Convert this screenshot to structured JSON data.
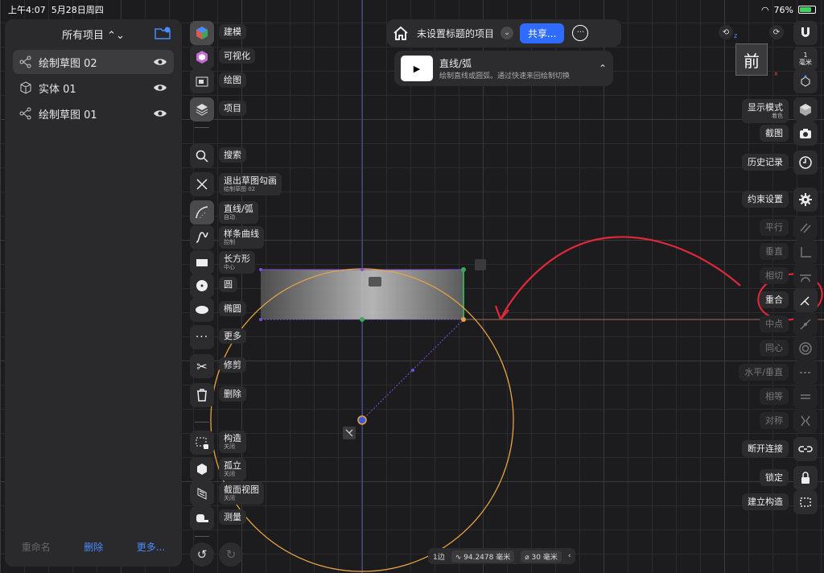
{
  "status_bar": {
    "time": "上午4:07",
    "date": "5月28日周四",
    "battery": "76%",
    "battery_level": 0.76
  },
  "left_panel": {
    "header": "所有项目 ⌃⌄",
    "items": [
      {
        "label": "绘制草图 02",
        "icon": "sketch-icon",
        "selected": true
      },
      {
        "label": "实体  01",
        "icon": "cube-icon",
        "selected": false
      },
      {
        "label": "绘制草图 01",
        "icon": "sketch-icon",
        "selected": false
      }
    ],
    "footer": {
      "rename": "重命名",
      "delete": "删除",
      "more": "更多..."
    }
  },
  "tools": {
    "modeling": "建模",
    "visualize": "可视化",
    "drawing": "绘图",
    "project": "项目",
    "search": "搜索",
    "exit_sketch": "退出草图勾画",
    "exit_sketch_sub": "绘制草图 02",
    "line_arc": "直线/弧",
    "line_arc_sub": "自动",
    "spline": "样条曲线",
    "spline_sub": "控制",
    "rectangle": "长方形",
    "rectangle_sub": "中心",
    "circle": "圆",
    "ellipse": "椭圆",
    "more": "更多",
    "trim": "修剪",
    "delete": "删除",
    "construct": "构造",
    "construct_sub": "关闭",
    "isolate": "孤立",
    "isolate_sub": "关闭",
    "section": "截面视图",
    "section_sub": "关闭",
    "measure": "测量"
  },
  "topbar": {
    "title": "未设置标题的项目",
    "share": "共享...",
    "more_icon": "ellipsis-icon"
  },
  "hint": {
    "thumb": "▶",
    "title": "直线/弧",
    "description": "绘制直线或圆弧。通过快速来回绘制切换"
  },
  "right": {
    "units": "毫米",
    "unit_value": "1",
    "view_face": "前",
    "display_mode": "显示模式",
    "display_mode_sub": "着色",
    "screenshot": "截图",
    "history": "历史记录",
    "constraints": "约束设置",
    "parallel": "平行",
    "perpendicular": "垂直",
    "tangent": "相切",
    "coincident": "重合",
    "midpoint": "中点",
    "concentric": "同心",
    "horizontal_vertical": "水平/垂直",
    "equal": "相等",
    "symmetric": "对称",
    "disconnect": "断开连接",
    "lock": "锁定",
    "build_construct": "建立构造"
  },
  "bottom_status": {
    "edges": "1边",
    "length": "94.2478 毫米",
    "diameter": "30 毫米"
  },
  "colors": {
    "accent": "#2f6bff",
    "circle": "#e8a345",
    "selection": "#7a4fd6",
    "annotation": "#e0283a",
    "vertical_line": "#3aa85a"
  }
}
